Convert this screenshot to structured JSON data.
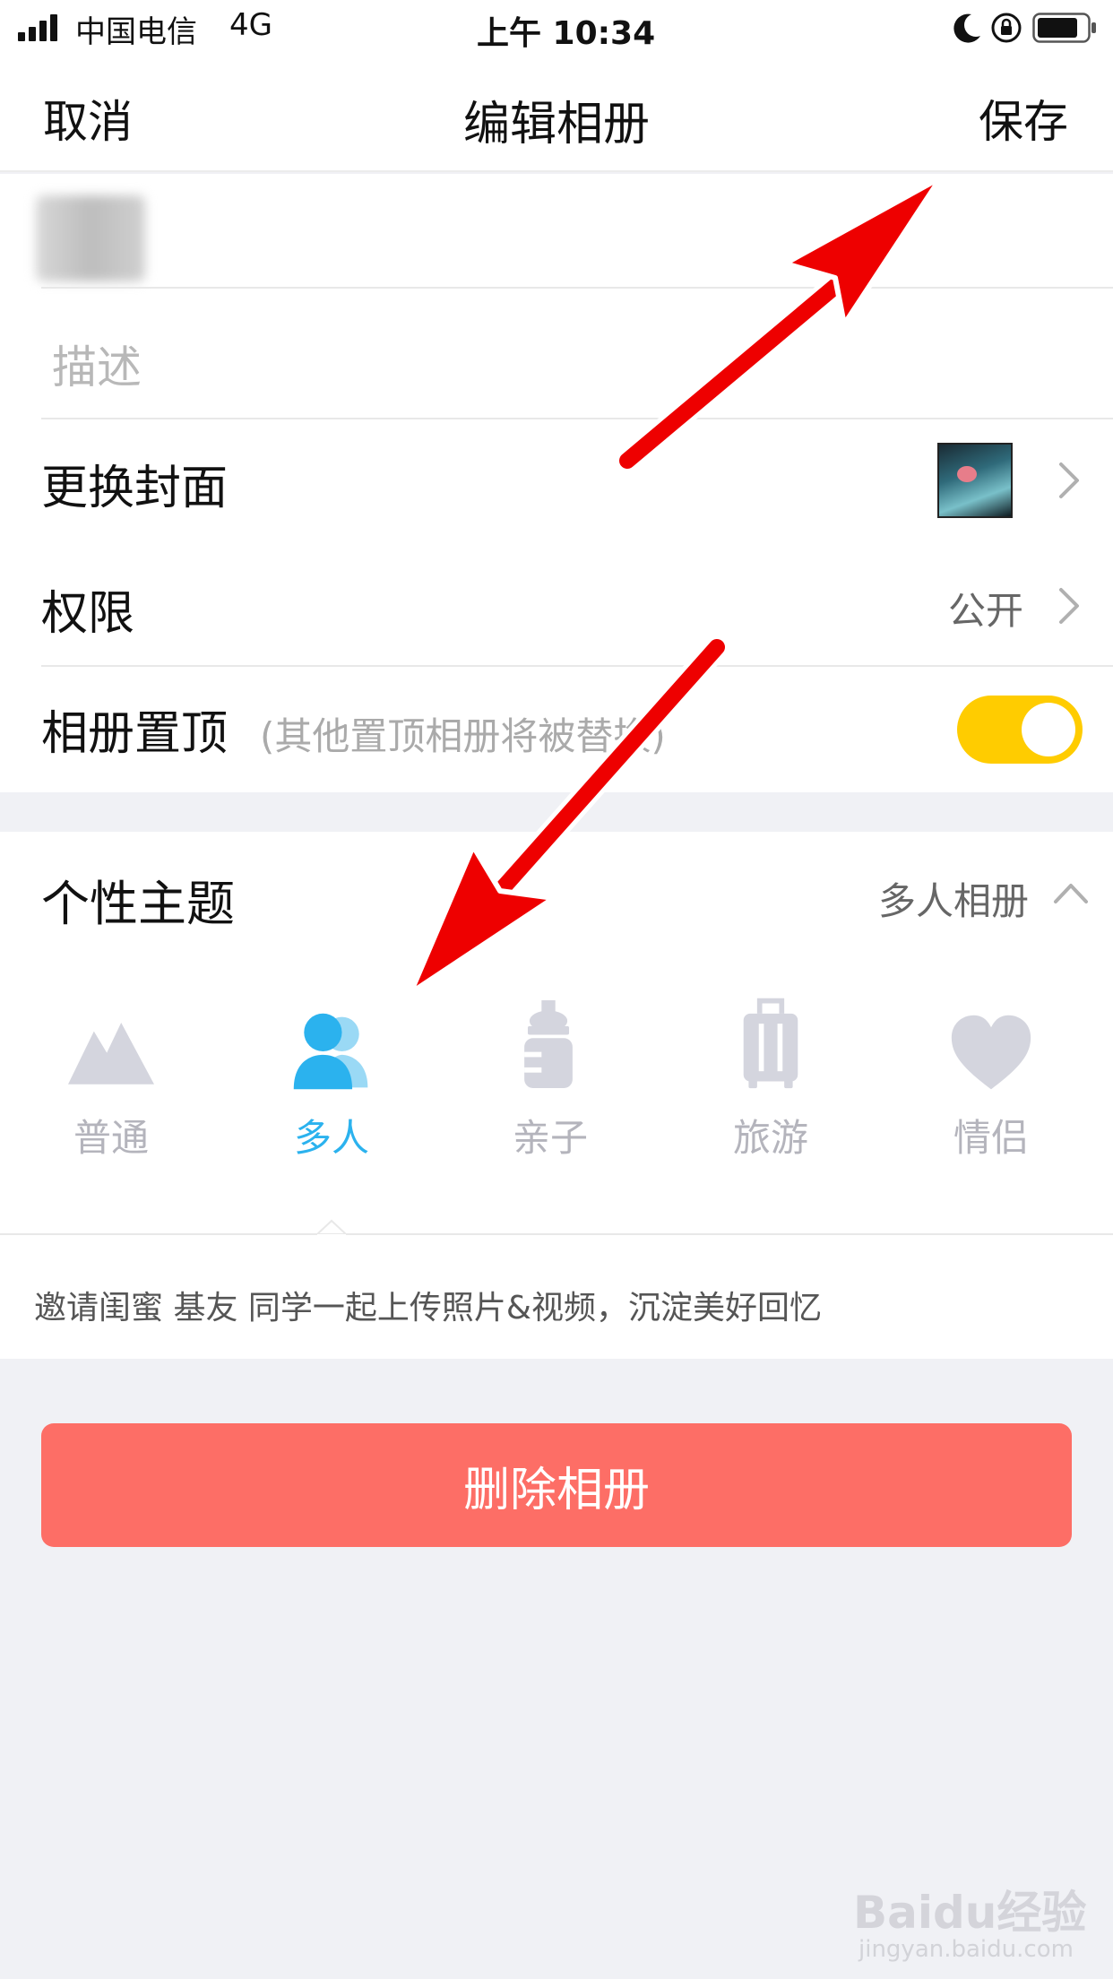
{
  "status": {
    "carrier": "中国电信",
    "network": "4G",
    "time": "上午 10:34"
  },
  "nav": {
    "cancel": "取消",
    "title": "编辑相册",
    "save": "保存"
  },
  "form": {
    "description_placeholder": "描述",
    "cover_label": "更换封面",
    "permission_label": "权限",
    "permission_value": "公开",
    "pin_label": "相册置顶",
    "pin_hint": "(其他置顶相册将被替换)",
    "pin_enabled": true
  },
  "theme": {
    "label": "个性主题",
    "selected_value": "多人相册",
    "options": [
      {
        "label": "普通",
        "icon": "mountain-icon",
        "active": false
      },
      {
        "label": "多人",
        "icon": "people-icon",
        "active": true
      },
      {
        "label": "亲子",
        "icon": "baby-bottle-icon",
        "active": false
      },
      {
        "label": "旅游",
        "icon": "luggage-icon",
        "active": false
      },
      {
        "label": "情侣",
        "icon": "heart-icon",
        "active": false
      }
    ],
    "description": "邀请闺蜜 基友 同学一起上传照片&视频，沉淀美好回忆"
  },
  "delete_label": "删除相册",
  "watermark": {
    "brand": "Baidu经验",
    "url": "jingyan.baidu.com"
  },
  "colors": {
    "accent_toggle": "#ffcc00",
    "active_theme": "#2bb2ee",
    "delete": "#fd6e66",
    "arrow": "#ee0000"
  }
}
